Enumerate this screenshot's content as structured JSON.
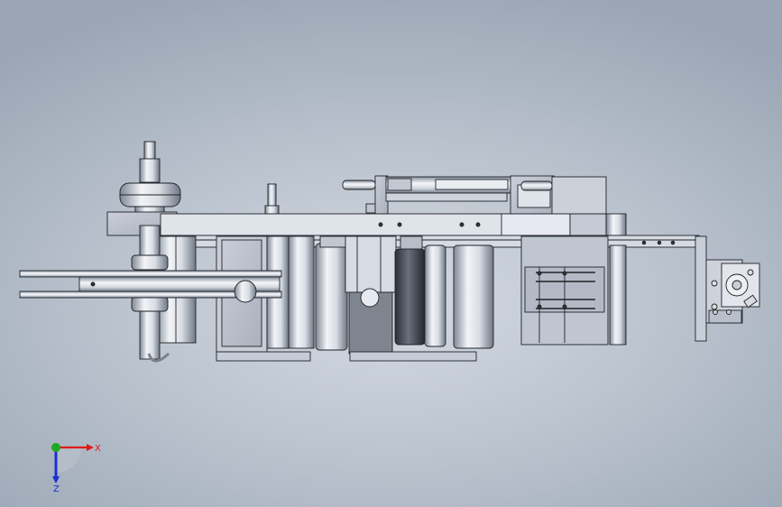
{
  "viewport": {
    "background_center": "#d4dae2",
    "background_edge": "#9aa6b5"
  },
  "triad": {
    "x_label": "X",
    "z_label": "Z",
    "x_color": "#e01b1b",
    "y_color": "#1fa81f",
    "z_color": "#1a2fd6"
  }
}
